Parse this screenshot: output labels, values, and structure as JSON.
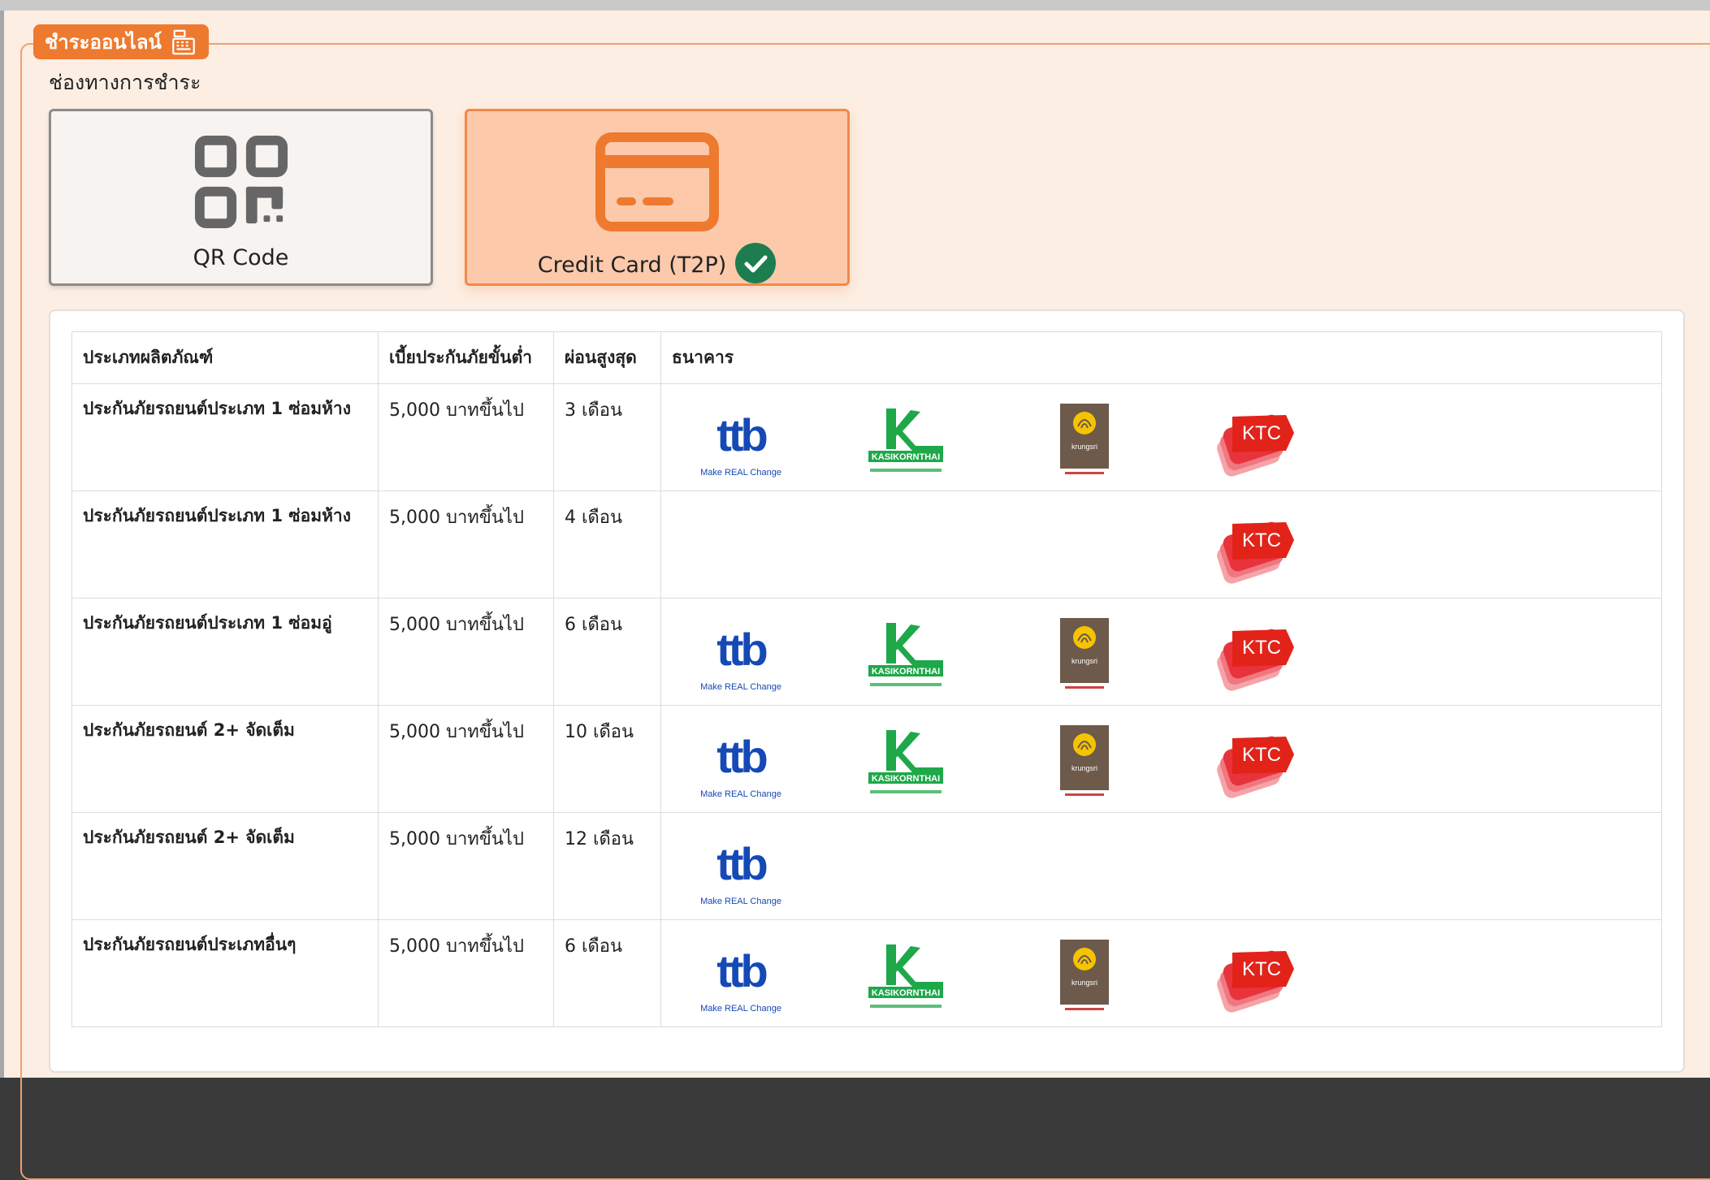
{
  "section": {
    "title": "ชำระออนไลน์",
    "channel_label": "ช่องทางการชำระ"
  },
  "payment_methods": [
    {
      "label": "QR Code",
      "selected": false
    },
    {
      "label": "Credit Card (T2P)",
      "selected": true
    }
  ],
  "table": {
    "headers": [
      "ประเภทผลิตภัณฑ์",
      "เบี้ยประกันภัยขั้นต่ำ",
      "ผ่อนสูงสุด",
      "ธนาคาร"
    ],
    "rows": [
      {
        "product": "ประกันภัยรถยนต์ประเภท 1 ซ่อมห้าง",
        "min_premium": "5,000 บาทขึ้นไป",
        "max_installment": "3 เดือน",
        "banks": [
          "ttb",
          "kasikornthai",
          "krungsri",
          "ktc"
        ]
      },
      {
        "product": "ประกันภัยรถยนต์ประเภท 1 ซ่อมห้าง",
        "min_premium": "5,000 บาทขึ้นไป",
        "max_installment": "4 เดือน",
        "banks": [
          "ktc"
        ]
      },
      {
        "product": "ประกันภัยรถยนต์ประเภท 1 ซ่อมอู่",
        "min_premium": "5,000 บาทขึ้นไป",
        "max_installment": "6 เดือน",
        "banks": [
          "ttb",
          "kasikornthai",
          "krungsri",
          "ktc"
        ]
      },
      {
        "product": "ประกันภัยรถยนต์ 2+ จัดเต็ม",
        "min_premium": "5,000 บาทขึ้นไป",
        "max_installment": "10 เดือน",
        "banks": [
          "ttb",
          "kasikornthai",
          "krungsri",
          "ktc"
        ]
      },
      {
        "product": "ประกันภัยรถยนต์ 2+ จัดเต็ม",
        "min_premium": "5,000 บาทขึ้นไป",
        "max_installment": "12 เดือน",
        "banks": [
          "ttb"
        ]
      },
      {
        "product": "ประกันภัยรถยนต์ประเภทอื่นๆ",
        "min_premium": "5,000 บาทขึ้นไป",
        "max_installment": "6 เดือน",
        "banks": [
          "ttb",
          "kasikornthai",
          "krungsri",
          "ktc"
        ]
      }
    ]
  },
  "bank_logos": {
    "ttb": {
      "text": "ttb",
      "tagline": "Make REAL Change"
    },
    "kasikornthai": {
      "text": "KASIKORNTHAI"
    },
    "krungsri": {
      "text": "krungsri"
    },
    "ktc": {
      "text": "KTC"
    }
  },
  "colors": {
    "accent": "#ee7a2f",
    "background": "#fdeee3",
    "selected_card": "#fcc9ab",
    "check": "#1e7d4f"
  }
}
